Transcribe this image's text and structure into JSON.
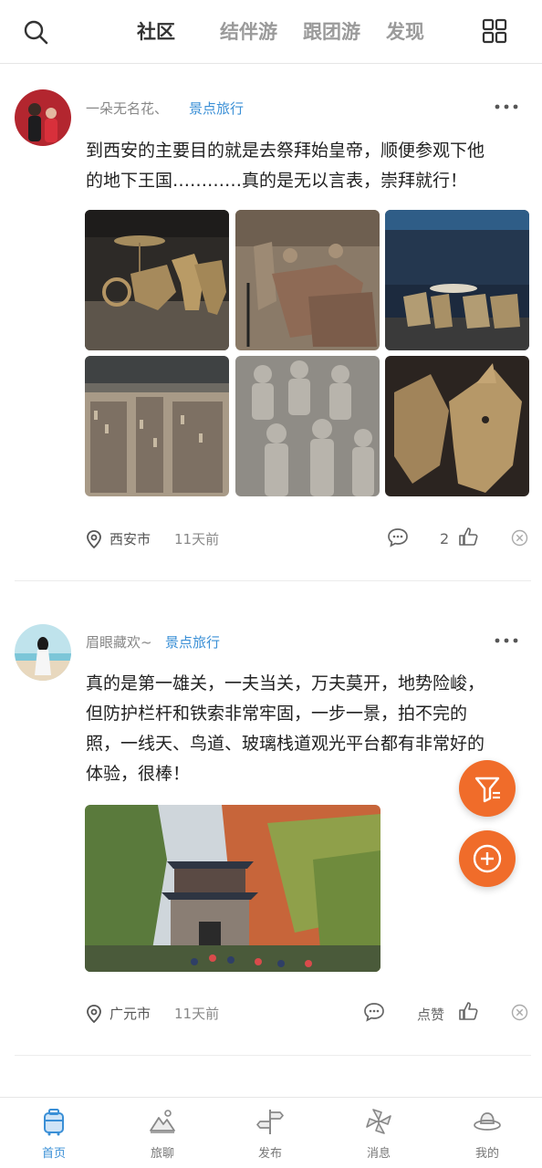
{
  "header": {
    "tabs": [
      {
        "label": "社区",
        "active": true
      },
      {
        "label": "结伴游",
        "active": false
      },
      {
        "label": "跟团游",
        "active": false
      },
      {
        "label": "发现",
        "active": false
      }
    ],
    "icons": {
      "search": "search-icon",
      "grid": "grid-menu-icon"
    }
  },
  "posts": [
    {
      "author": "一朵无名花、",
      "tag": "景点旅行",
      "text_line1": "到西安的主要目的就是去祭拜始皇帝，顺便参观下他",
      "text_line2": "的地下王国…………真的是无以言表，崇拜就行！",
      "images": [
        "terracotta-bronze-chariot-photo",
        "terracotta-warriors-horses-photo",
        "museum-horses-hall-photo",
        "terracotta-pit-overview-photo",
        "terracotta-warriors-rows-photo",
        "bronze-horse-closeup-photo"
      ],
      "location": "西安市",
      "time": "11天前",
      "like_count": "2"
    },
    {
      "author": "眉眼藏欢~",
      "tag": "景点旅行",
      "text_line1": "真的是第一雄关，一夫当关，万夫莫开，地势险峻，",
      "text_line2": "但防护栏杆和铁索非常牢固，一步一景，拍不完的",
      "text_line3": "照，一线天、鸟道、玻璃栈道观光平台都有非常好的",
      "text_line4": "体验，很棒！",
      "images": [
        "jianmen-pass-tower-photo"
      ],
      "location": "广元市",
      "time": "11天前",
      "like_label": "点赞"
    }
  ],
  "fabs": {
    "filter": "filter-icon",
    "add": "plus-icon"
  },
  "colors": {
    "accent": "#3a8fd6",
    "fab": "#f06c2a"
  },
  "nav": [
    {
      "label": "首页",
      "icon": "luggage-icon",
      "active": true
    },
    {
      "label": "旅聊",
      "icon": "mountain-icon",
      "active": false
    },
    {
      "label": "发布",
      "icon": "signpost-icon",
      "active": false
    },
    {
      "label": "消息",
      "icon": "pinwheel-icon",
      "active": false
    },
    {
      "label": "我的",
      "icon": "hat-icon",
      "active": false
    }
  ]
}
